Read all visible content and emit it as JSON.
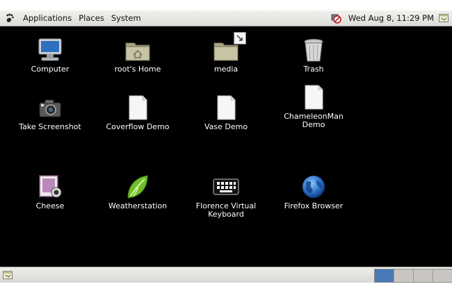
{
  "top_panel": {
    "menus": [
      "Applications",
      "Places",
      "System"
    ],
    "clock": "Wed Aug  8, 11:29 PM",
    "tray": {
      "network": "network-blocked-icon",
      "notes": "tomboy-notes-icon"
    }
  },
  "desktop": {
    "icons": [
      {
        "label": "Computer",
        "icon": "computer-icon"
      },
      {
        "label": "root's Home",
        "icon": "home-folder-icon"
      },
      {
        "label": "media",
        "icon": "folder-link-icon"
      },
      {
        "label": "Trash",
        "icon": "trash-icon"
      },
      {
        "label": "Take Screenshot",
        "icon": "camera-icon"
      },
      {
        "label": "Coverflow Demo",
        "icon": "document-icon"
      },
      {
        "label": "Vase Demo",
        "icon": "document-icon"
      },
      {
        "label": "ChameleonMan\nDemo",
        "icon": "document-icon"
      },
      {
        "label": "Cheese",
        "icon": "cheese-webcam-icon"
      },
      {
        "label": "Weatherstation",
        "icon": "leaf-icon"
      },
      {
        "label": "Florence Virtual\nKeyboard",
        "icon": "keyboard-icon"
      },
      {
        "label": "Firefox Browser",
        "icon": "firefox-globe-icon"
      }
    ]
  },
  "bottom_panel": {
    "show_desktop_icon": "show-desktop-icon",
    "workspaces": {
      "count": 4,
      "active": 1
    }
  },
  "colors": {
    "desktop_bg": "#000000",
    "workspace_active": "#4a79b7"
  }
}
